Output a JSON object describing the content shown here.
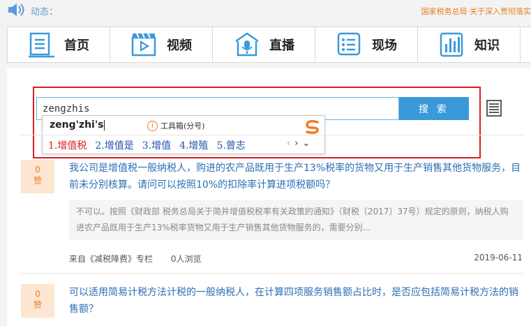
{
  "notice": {
    "label": "动态：",
    "ticker": "国家税务总局 关于深入贯彻落实"
  },
  "nav": [
    {
      "label": "首页",
      "icon": "home-document-icon"
    },
    {
      "label": "视频",
      "icon": "video-film-icon"
    },
    {
      "label": "直播",
      "icon": "live-microphone-icon"
    },
    {
      "label": "现场",
      "icon": "onsite-list-icon"
    },
    {
      "label": "知识",
      "icon": "knowledge-chart-icon"
    }
  ],
  "search": {
    "value": "zengzhis",
    "button_label": "搜 索"
  },
  "ime": {
    "pinyin": "zeng'zhi's",
    "tools_label": "工具箱(分号)",
    "candidates": [
      "1.增值税",
      "2.增值是",
      "3.增值",
      "4.增殖",
      "5.曾志"
    ],
    "prev": "‹",
    "next": "›",
    "expand": "⌄"
  },
  "items": [
    {
      "likes": "0",
      "like_label": "赞",
      "question": "我公司是增值税一般纳税人，购进的农产品既用于生产13%税率的货物又用于生产销售其他货物服务，目前未分别核算。请问可以按照10%的扣除率计算进项税额吗？",
      "answer": "不可以。按照《财政部 税务总局关于简并增值税税率有关政策的通知》（财税〔2017〕37号）规定的原则，纳税人购进农产品既用于生产13%税率货物又用于生产销售其他货物服务的，需要分别...",
      "source": "来自《减税降费》专栏",
      "views": "0人浏览",
      "date": "2019-06-11"
    },
    {
      "likes": "0",
      "like_label": "赞",
      "question": "可以适用简易计税方法计税的一般纳税人，在计算四项服务销售额占比时，是否应包括简易计税方法的销售额？"
    }
  ],
  "colors": {
    "accent_blue": "#3a9ad9",
    "link_blue": "#2b6fb6",
    "highlight_red": "#d91e1e",
    "orange": "#e67e22"
  }
}
